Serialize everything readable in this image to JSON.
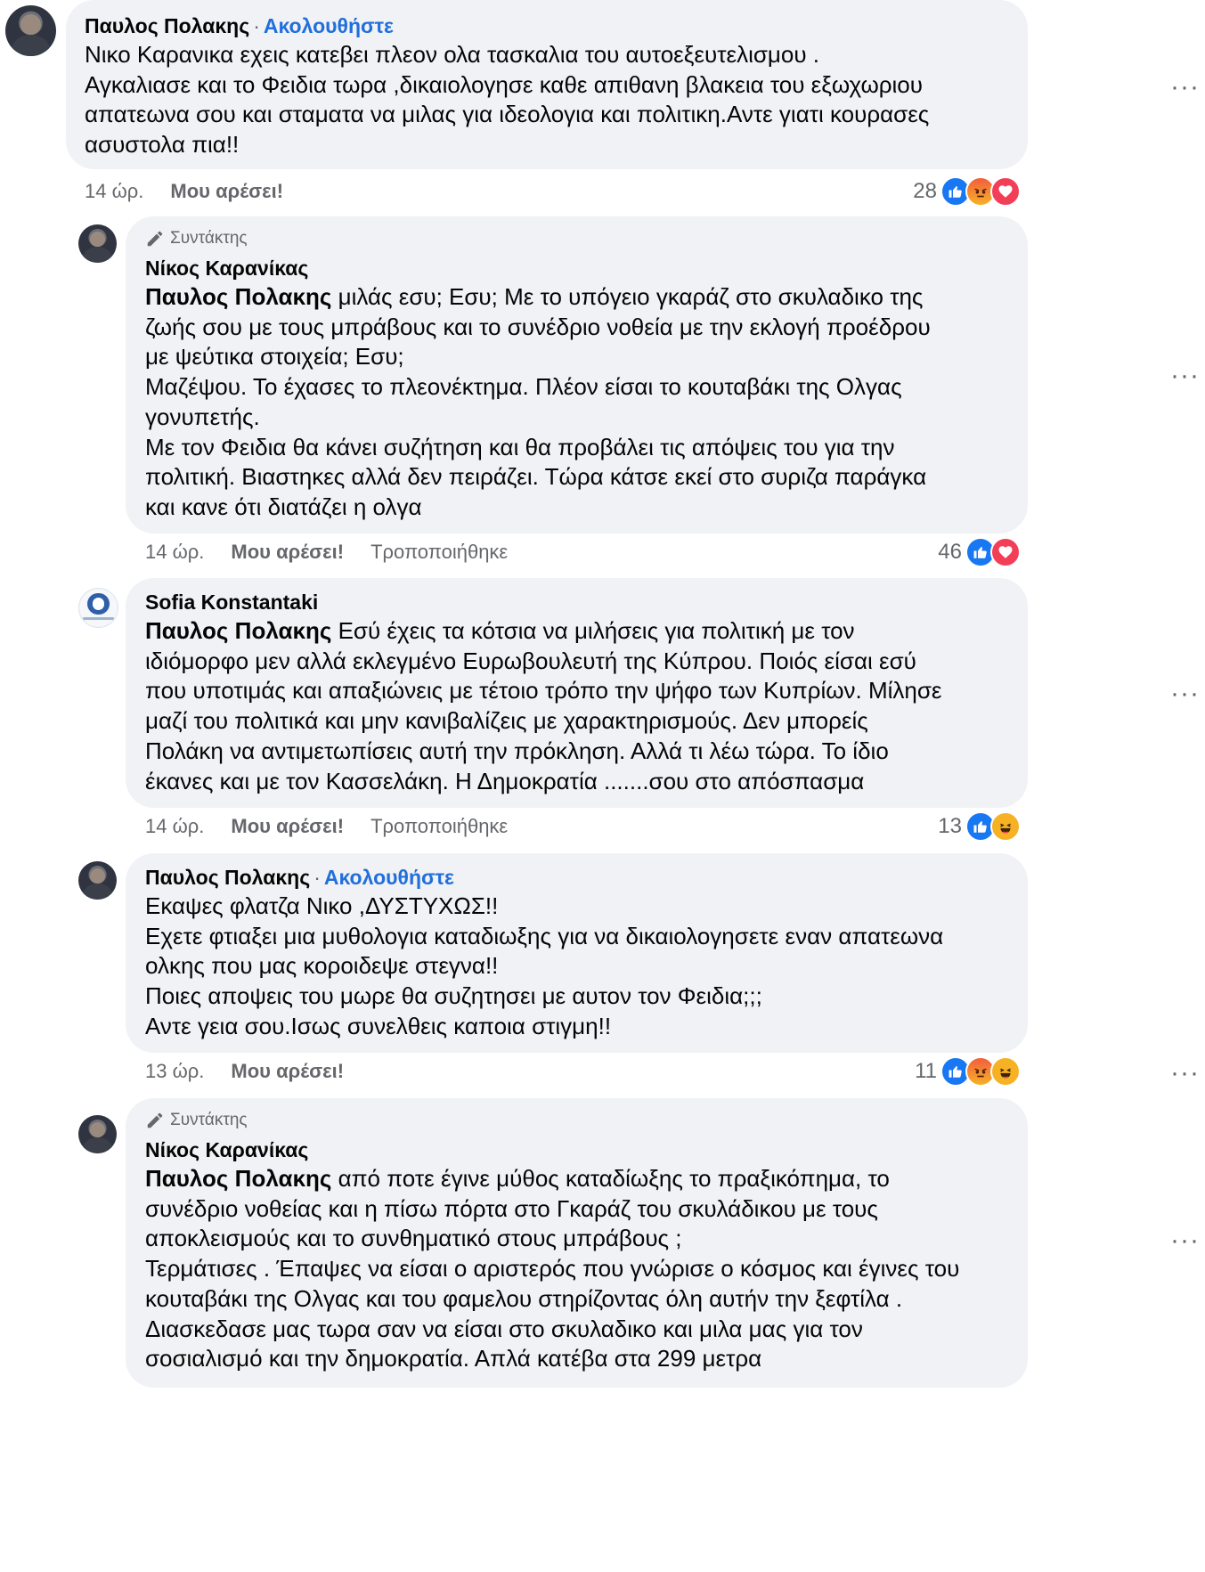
{
  "comments": [
    {
      "author": "Παυλος Πολακης",
      "follow": "Ακολουθήστε",
      "text": "Νικο Καρανικα εχεις κατεβει πλεον ολα τασκαλια του αυτοεξευτελισμου .\nΑγκαλιασε και το Φειδια τωρα ,δικαιολογησε καθε απιθανη βλακεια του εξωχωριου\nαπατεωνα σου και σταματα να μιλας για ιδεολογια και πολιτικη.Αντε γιατι κουρασες\nασυστολα πια!!",
      "time": "14 ώρ.",
      "like": "Μου αρέσει!",
      "reactions": {
        "count": "28",
        "types": [
          "like",
          "angry",
          "love"
        ]
      }
    },
    {
      "badge": "Συντάκτης",
      "author": "Νίκος Καρανίκας",
      "mention": "Παυλος Πολακης",
      "text": " μιλάς εσυ; Εσυ; Με το υπόγειο γκαράζ στο σκυλαδικο της\nζωής σου με τους μπράβους και το συνέδριο νοθεία με την εκλογή προέδρου\nμε ψεύτικα στοιχεία; Εσυ;\nΜαζέψου. Το έχασες το πλεονέκτημα. Πλέον είσαι το κουταβάκι της Ολγας\nγονυπετής.\nΜε τον Φειδια θα κάνει συζήτηση και θα προβάλει τις απόψεις του για την\nπολιτική. Βιαστηκες αλλά δεν πειράζει. Τώρα κάτσε εκεί στο συριζα παράγκα\nκαι κανε ότι διατάζει η ολγα",
      "time": "14 ώρ.",
      "like": "Μου αρέσει!",
      "edited": "Τροποποιήθηκε",
      "reactions": {
        "count": "46",
        "types": [
          "like",
          "love"
        ]
      }
    },
    {
      "author": "Sofia Konstantaki",
      "mention": "Παυλος Πολακης",
      "text": " Εσύ έχεις τα κότσια να μιλήσεις για πολιτική με τον\nιδιόμορφο μεν αλλά εκλεγμένο Ευρωβουλευτή της Κύπρου. Ποιός είσαι εσύ\nπου υποτιμάς και απαξιώνεις με τέτοιο τρόπο την ψήφο των Κυπρίων. Μίλησε\nμαζί του πολιτικά και μην κανιβαλίζεις με χαρακτηρισμούς. Δεν μπορείς\nΠολάκη να αντιμετωπίσεις αυτή την πρόκληση. Αλλά τι λέω τώρα. Το ίδιο\nέκανες και με τον Κασσελάκη. Η Δημοκρατία .......σου στο απόσπασμα",
      "time": "14 ώρ.",
      "like": "Μου αρέσει!",
      "edited": "Τροποποιήθηκε",
      "reactions": {
        "count": "13",
        "types": [
          "like",
          "haha"
        ]
      }
    },
    {
      "author": "Παυλος Πολακης",
      "follow": "Ακολουθήστε",
      "text": "Εκαψες φλατζα Νικο ,ΔΥΣΤΥΧΩΣ!!\nΕχετε φτιαξει μια μυθολογια καταδιωξης για να δικαιολογησετε εναν απατεωνα\nολκης που μας κοροιδεψε στεγνα!!\nΠοιες αποψεις του μωρε θα συζητησει με αυτον τον Φειδια;;;\nΑντε γεια σου.Ισως συνελθεις καποια στιγμη!!",
      "time": "13 ώρ.",
      "like": "Μου αρέσει!",
      "reactions": {
        "count": "11",
        "types": [
          "like",
          "angry",
          "haha"
        ]
      }
    },
    {
      "badge": "Συντάκτης",
      "author": "Νίκος Καρανίκας",
      "mention": "Παυλος Πολακης",
      "text": " από ποτε έγινε μύθος καταδίωξης το πραξικόπημα, το\nσυνέδριο νοθείας και η πίσω πόρτα στο Γκαράζ του σκυλάδικου με τους\nαποκλεισμούς και το συνθηματικό στους μπράβους ;\nΤερμάτισες . Έπαψες να είσαι ο αριστερός που γνώρισε ο κόσμος και έγινες του\nκουταβάκι της Ολγας και του φαμελου στηρίζοντας όλη αυτήν την ξεφτίλα .\nΔιασκεδασε μας τωρα σαν να είσαι στο σκυλαδικο και μιλα μας για τον\nσοσιαλισμό και την δημοκρατία. Απλά κατέβα στα 299 μετρα"
    }
  ],
  "colors": {
    "bubble": "#f0f2f5",
    "link": "#216fdb",
    "meta": "#65676b",
    "like": "#1877f2",
    "love": "#f33e58",
    "haha": "#f7b125"
  },
  "icons": {
    "more": "more-options-icon",
    "badge": "pencil-icon"
  }
}
